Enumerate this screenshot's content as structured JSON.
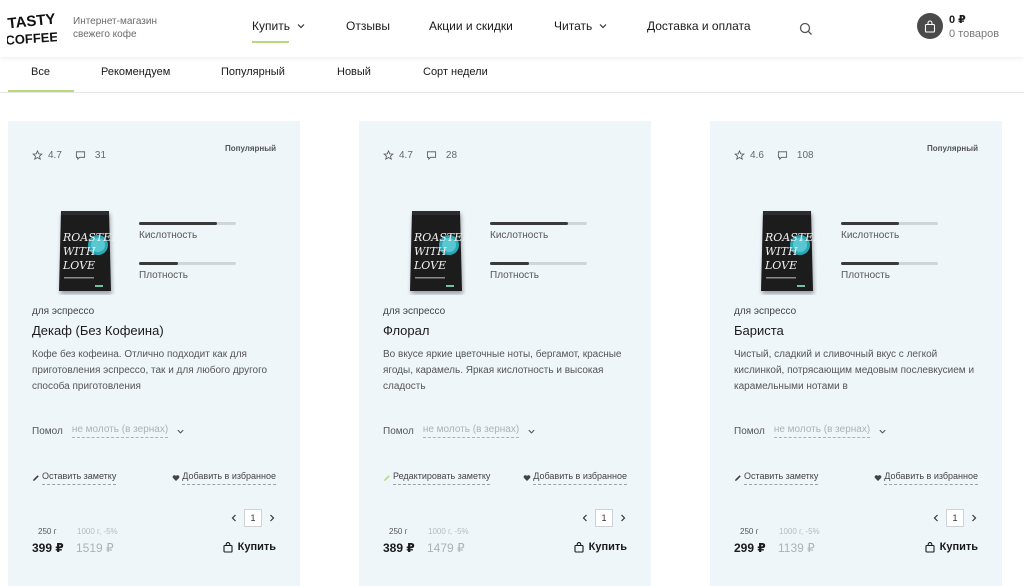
{
  "header": {
    "logo_text": "TASTY COFFEE",
    "tagline_line1": "Интернет-магазин",
    "tagline_line2": "свежего кофе",
    "nav": [
      {
        "label": "Купить",
        "has_dropdown": true
      },
      {
        "label": "Отзывы",
        "has_dropdown": false
      },
      {
        "label": "Акции и скидки",
        "has_dropdown": false
      },
      {
        "label": "Читать",
        "has_dropdown": true
      },
      {
        "label": "Доставка и оплата",
        "has_dropdown": false
      }
    ],
    "cart_sum": "0 ₽",
    "cart_count": "0 товаров",
    "search_icon": "search-icon",
    "cart_icon": "shopping-bag-icon"
  },
  "tabs": [
    {
      "label": "Все",
      "active": true
    },
    {
      "label": "Рекомендуем",
      "active": false
    },
    {
      "label": "Популярный",
      "active": false
    },
    {
      "label": "Новый",
      "active": false
    },
    {
      "label": "Сорт недели",
      "active": false
    }
  ],
  "labels": {
    "acidity": "Кислотность",
    "density": "Плотность",
    "grind_label": "Помол",
    "grind_value": "не молоть (в зернах)",
    "add_favorite": "Добавить в избранное",
    "buy": "Купить",
    "qty": "1"
  },
  "products": [
    {
      "rating": "4.7",
      "comments": "31",
      "badge": "Популярный",
      "acidity": 0.8,
      "density": 0.4,
      "category": "для эспрессо",
      "title": "Декаф (Без Кофеина)",
      "description": "Кофе без кофеина. Отлично подходит как для приготовления эспрессо, так и для любого другого способа приготовления",
      "note_label": "Оставить заметку",
      "weight": "250 г",
      "alt_weight": "1000 г, -5%",
      "price": "399 ₽",
      "old_price": "1519 ₽"
    },
    {
      "rating": "4.7",
      "comments": "28",
      "badge": "",
      "acidity": 0.8,
      "density": 0.4,
      "category": "для эспрессо",
      "title": "Флорал",
      "description": "Во вкусе яркие цветочные ноты, бергамот, красные ягоды, карамель. Яркая кислотность и высокая сладость",
      "note_label": "Редактировать заметку",
      "weight": "250 г",
      "alt_weight": "1000 г, -5%",
      "price": "389 ₽",
      "old_price": "1479 ₽"
    },
    {
      "rating": "4.6",
      "comments": "108",
      "badge": "Популярный",
      "acidity": 0.6,
      "density": 0.6,
      "category": "для эспрессо",
      "title": "Бариста",
      "description": "Чистый, сладкий и сливочный вкус с легкой кислинкой, потрясающим медовым послевкусием и карамельными нотами в",
      "note_label": "Оставить заметку",
      "weight": "250 г",
      "alt_weight": "1000 г, -5%",
      "price": "299 ₽",
      "old_price": "1139 ₽"
    }
  ],
  "colors": {
    "accent_green": "#b7d97a",
    "card_bg": "#eef6fa",
    "note_edit_icon": "#b7d97a"
  }
}
